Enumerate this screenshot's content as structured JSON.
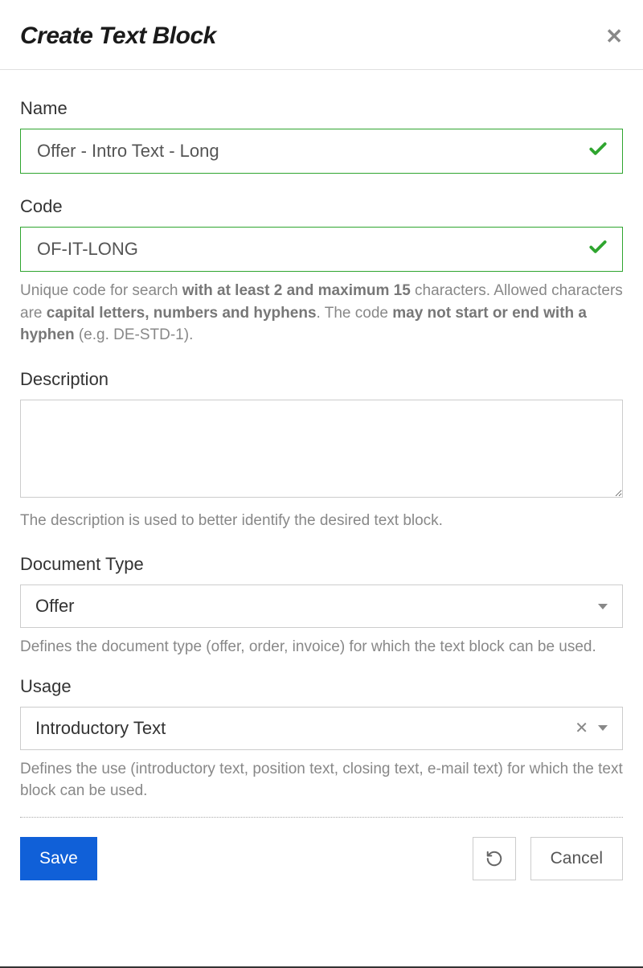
{
  "header": {
    "title": "Create Text Block"
  },
  "form": {
    "name": {
      "label": "Name",
      "value": "Offer - Intro Text - Long"
    },
    "code": {
      "label": "Code",
      "value": "OF-IT-LONG",
      "helper_parts": {
        "p1": "Unique code for search ",
        "p2": "with at least 2 and maximum 15",
        "p3": " characters. Allowed characters are ",
        "p4": "capital letters, numbers and hyphens",
        "p5": ". The code ",
        "p6": "may not start or end with a hyphen",
        "p7": " (e.g. DE-STD-1)."
      }
    },
    "description": {
      "label": "Description",
      "value": "",
      "helper": "The description is used to better identify the desired text block."
    },
    "document_type": {
      "label": "Document Type",
      "value": "Offer",
      "helper": "Defines the document type (offer, order, invoice) for which the text block can be used."
    },
    "usage": {
      "label": "Usage",
      "value": "Introductory Text",
      "helper": "Defines the use (introductory text, position text, closing text, e-mail text) for which the text block can be used."
    }
  },
  "footer": {
    "save": "Save",
    "cancel": "Cancel"
  }
}
